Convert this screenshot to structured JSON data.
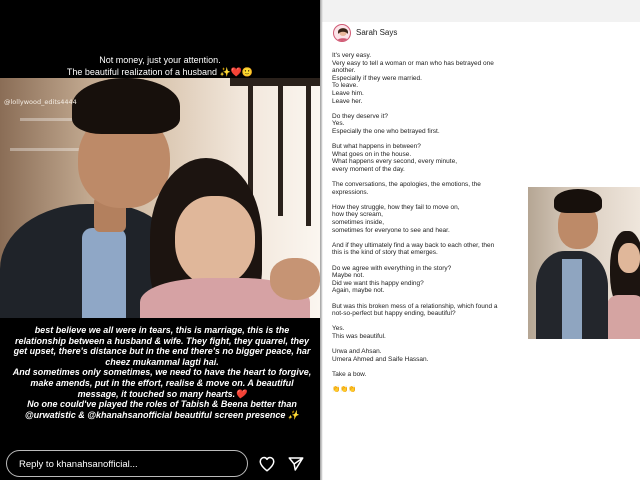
{
  "story": {
    "caption_top": [
      "Not money, just your attention.",
      "The beautiful realization of a husband ✨❤️🙂"
    ],
    "watermark": "@lollywood_edits4444",
    "caption_bottom": [
      "best believe we all were in tears, this is marriage, this is the relationship between a husband & wife. They fight, they quarrel, they get upset, there's distance but in the end there's no bigger peace, har cheez mukammal lagti hai.",
      "And sometimes only sometimes, we need to have the heart to forgive, make amends, put in the effort, realise & move on. A beautiful message, it touched so many hearts.❤️",
      "No one could've played the roles of Tabish & Beena better than @urwatistic & @khanahsanofficial beautiful screen presence ✨"
    ],
    "reply_placeholder": "Reply to khanahsanofficial...",
    "icons": {
      "like": "heart-icon",
      "share": "send-icon"
    }
  },
  "doc": {
    "author": "Sarah Says",
    "avatar_icon": "avatar-icon",
    "paragraphs": [
      [
        "It's very easy.",
        "Very easy to tell a woman or man who has betrayed one",
        "another.",
        "Especially if they were married.",
        "To leave.",
        "Leave him.",
        "Leave her."
      ],
      [
        "Do they deserve it?",
        "Yes.",
        "Especially the one who betrayed first."
      ],
      [
        "But what happens in between?",
        "What goes on in the house.",
        "What happens every second, every minute,",
        "every moment of the day."
      ],
      [
        "The conversations, the apologies, the emotions, the",
        "expressions."
      ],
      [
        "How they struggle, how they fail to move on,",
        "how they scream,",
        "sometimes inside,",
        "sometimes for everyone to see and hear."
      ],
      [
        "And if they ultimately find a way back to each other, then",
        "this is the kind of story that emerges."
      ],
      [
        "Do we agree with everything in the story?",
        "Maybe not.",
        "Did we want this happy ending?",
        "Again, maybe not."
      ],
      [
        "But was this broken mess of a relationship, which found a",
        "not-so-perfect but happy ending, beautiful?"
      ],
      [
        "Yes.",
        "This was beautiful."
      ],
      [
        "Urwa and Ahsan.",
        "Umera Ahmed and Saife Hassan."
      ],
      [
        "Take a bow."
      ],
      [
        "👏👏👏"
      ]
    ]
  },
  "colors": {
    "story_bg": "#000000",
    "doc_bg": "#ffffff",
    "avatar_ring": "#d05a74"
  }
}
